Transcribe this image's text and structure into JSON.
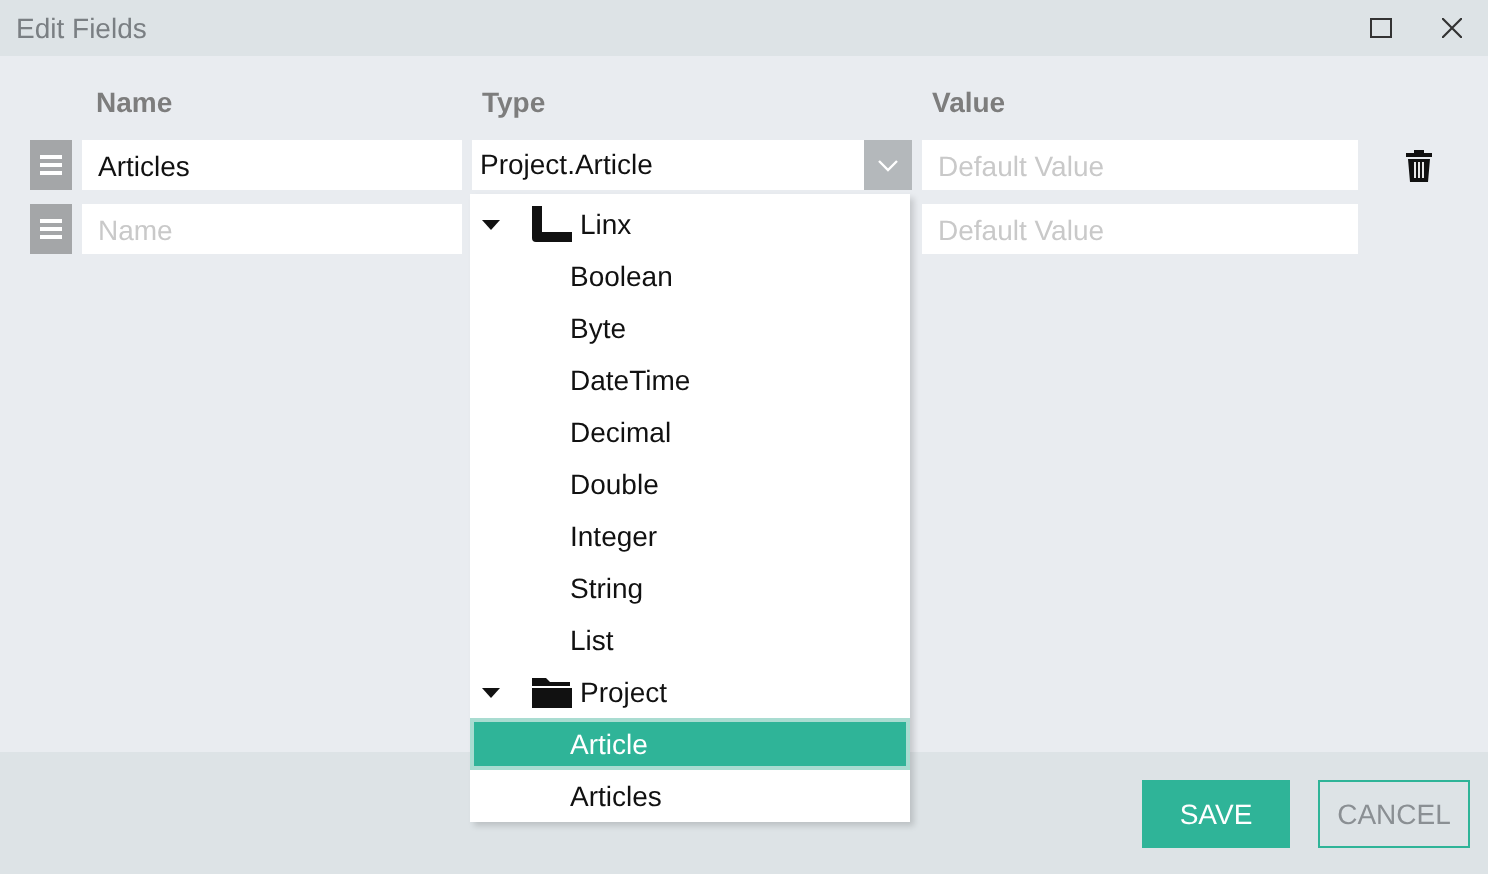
{
  "window": {
    "title": "Edit Fields"
  },
  "columns": [
    "Name",
    "Type",
    "Value"
  ],
  "fields": [
    {
      "name": {
        "value": "Articles"
      },
      "type": {
        "value": "Project.Article"
      },
      "value": {
        "placeholder": "Default Value"
      },
      "deletable": true
    },
    {
      "name": {
        "placeholder": "Name"
      },
      "value": {
        "placeholder": "Default Value"
      },
      "deletable": false
    }
  ],
  "type_dropdown": {
    "tree": [
      {
        "label": "Linx",
        "kind": "library",
        "expanded": true,
        "children": [
          {
            "label": "Boolean",
            "selected": false
          },
          {
            "label": "Byte",
            "selected": false
          },
          {
            "label": "DateTime",
            "selected": false
          },
          {
            "label": "Decimal",
            "selected": false
          },
          {
            "label": "Double",
            "selected": false
          },
          {
            "label": "Integer",
            "selected": false
          },
          {
            "label": "String",
            "selected": false
          },
          {
            "label": "List",
            "selected": false
          }
        ]
      },
      {
        "label": "Project",
        "kind": "folder",
        "expanded": true,
        "children": [
          {
            "label": "Article",
            "selected": true
          },
          {
            "label": "Articles",
            "selected": false
          }
        ]
      }
    ]
  },
  "buttons": [
    {
      "label": "SAVE",
      "kind": "primary"
    },
    {
      "label": "CANCEL",
      "kind": "secondary"
    }
  ]
}
